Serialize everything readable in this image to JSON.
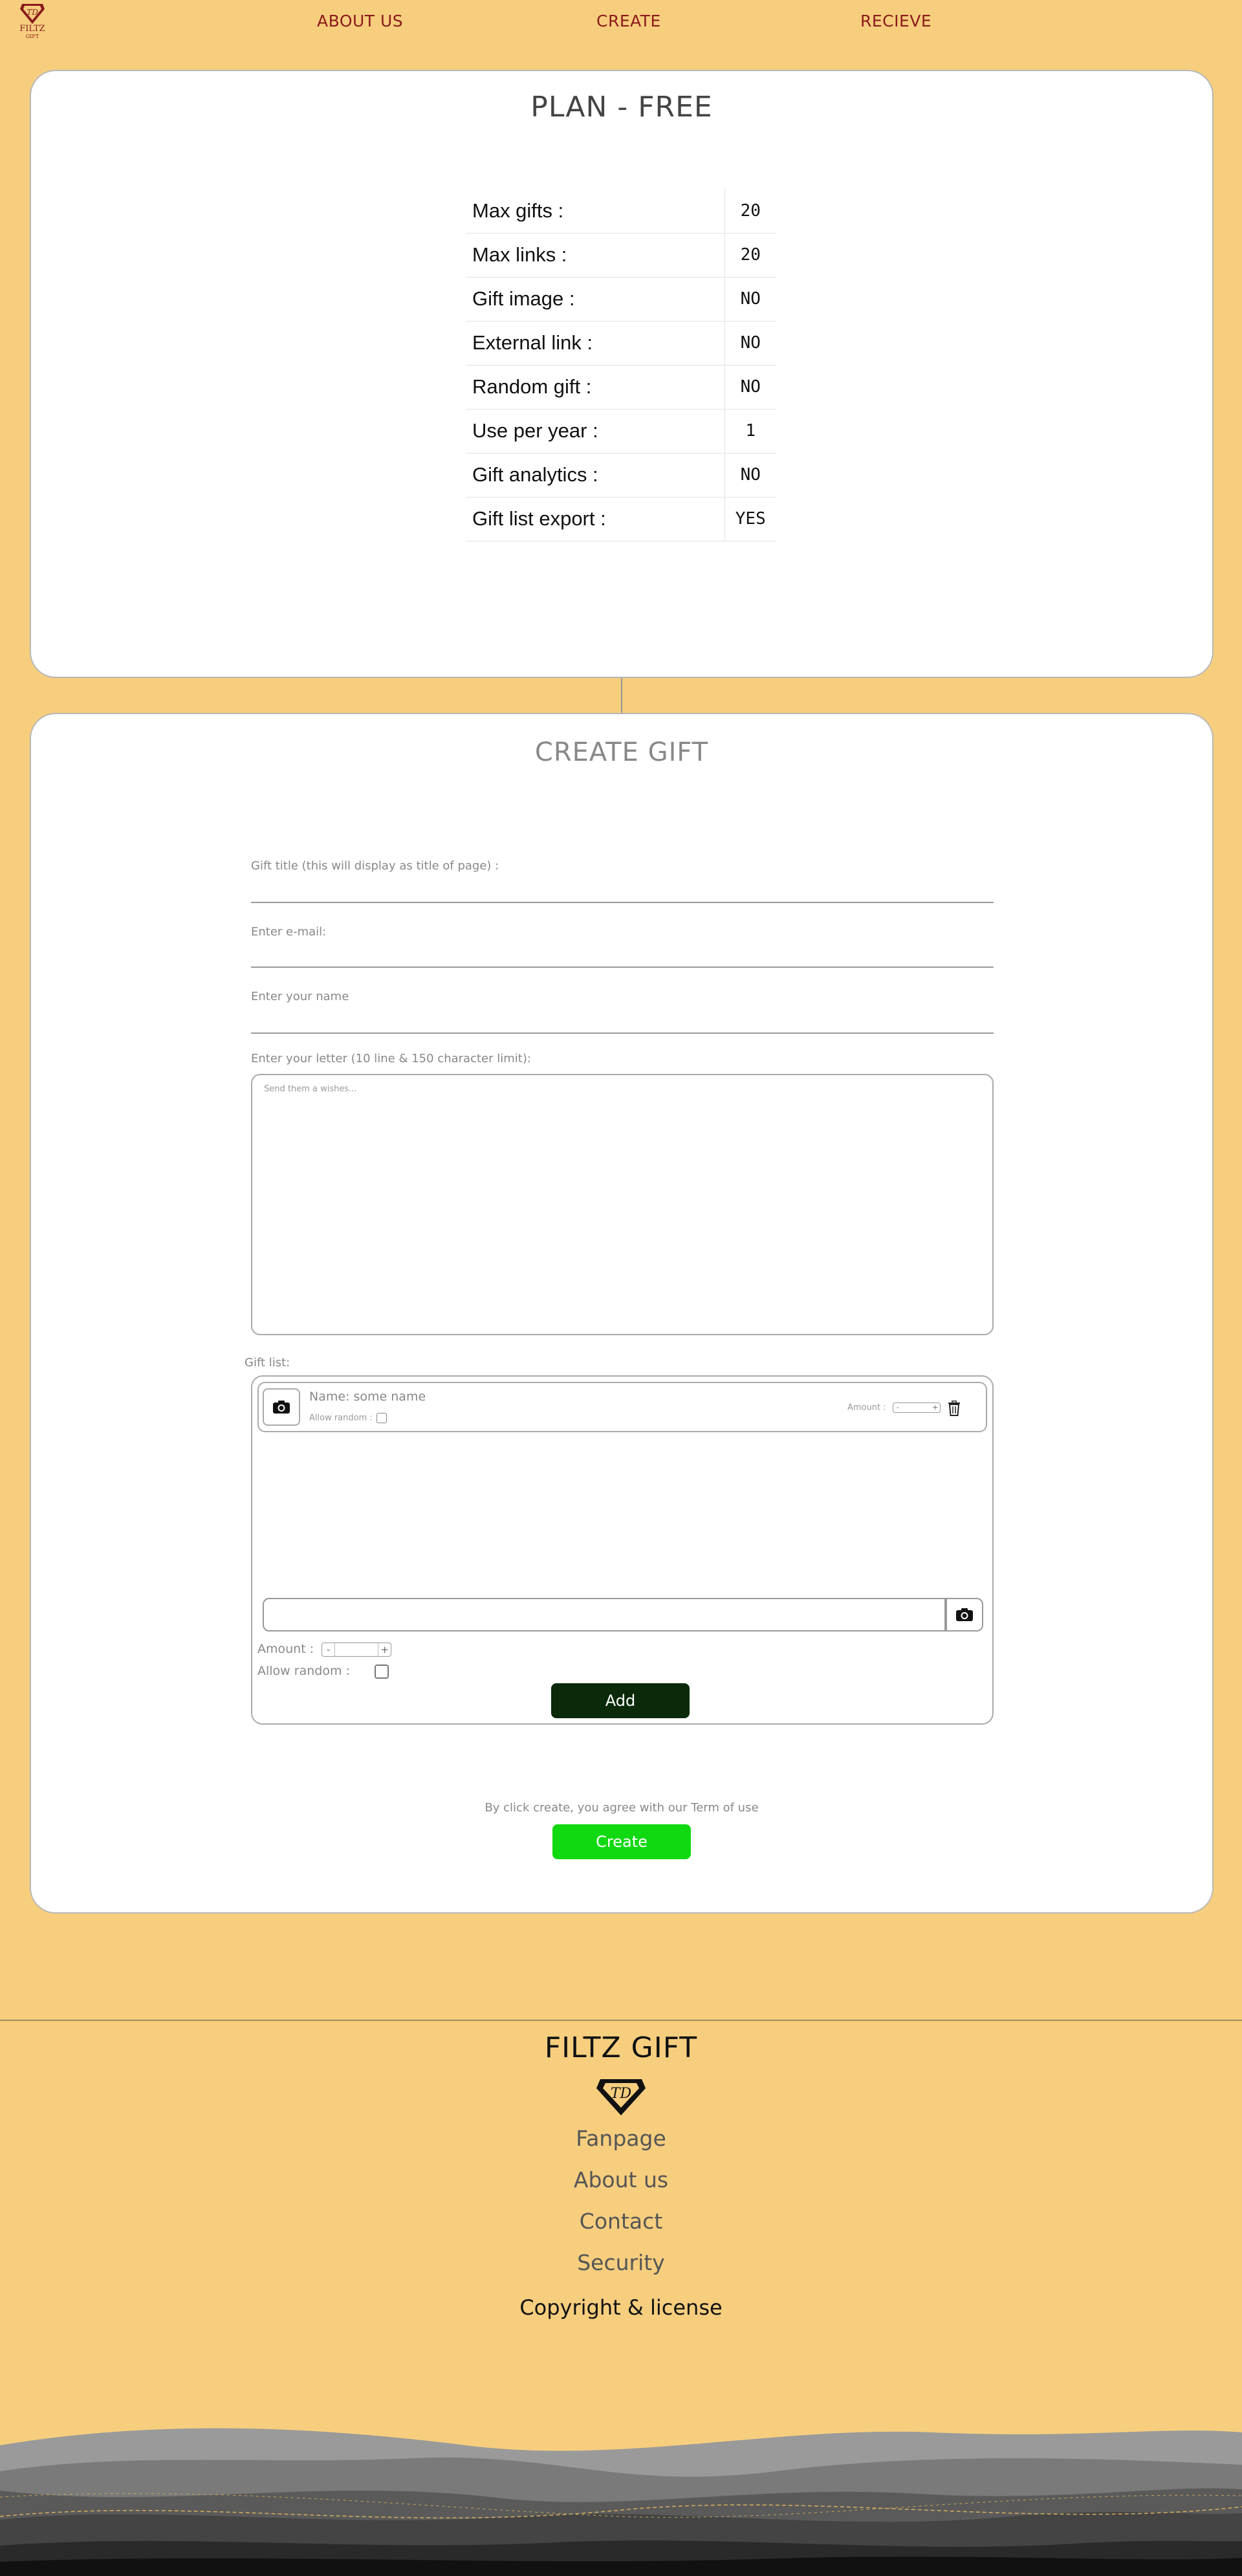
{
  "nav": {
    "logo_text": "FILTZ",
    "logo_sub": "GIFT",
    "links": [
      "ABOUT US",
      "CREATE",
      "RECIEVE"
    ]
  },
  "plan": {
    "title": "PLAN - FREE",
    "rows": [
      {
        "label": "Max gifts :",
        "value": "20"
      },
      {
        "label": "Max links :",
        "value": "20"
      },
      {
        "label": "Gift image :",
        "value": "NO"
      },
      {
        "label": "External link :",
        "value": "NO"
      },
      {
        "label": "Random gift :",
        "value": "NO"
      },
      {
        "label": "Use per year :",
        "value": "1"
      },
      {
        "label": "Gift analytics :",
        "value": "NO"
      },
      {
        "label": "Gift list export :",
        "value": "YES"
      }
    ]
  },
  "create": {
    "title": "CREATE GIFT",
    "gift_title_label": "Gift title (this will display as title of page) :",
    "email_label": "Enter e-mail:",
    "name_label": "Enter your name",
    "letter_label": "Enter your letter (10 line & 150 character limit):",
    "letter_placeholder": "Send them a wishes...",
    "gift_list_label": "Gift list:",
    "item": {
      "name": "Name: some name",
      "allow_random": "Allow random :",
      "amount": "Amount :",
      "stepper_minus": "-",
      "stepper_plus": "+"
    },
    "new_item": {
      "amount_label": "Amount :",
      "stepper_minus": "-",
      "stepper_plus": "+",
      "allow_random_label": "Allow random :",
      "add_label": "Add"
    },
    "terms": "By click create, you agree with our Term of use",
    "create_label": "Create"
  },
  "footer": {
    "title": "FILTZ GIFT",
    "links": [
      "Fanpage",
      "About us",
      "Contact",
      "Security"
    ],
    "copyright": "Copyright & license"
  },
  "colors": {
    "background": "#f6ce7e",
    "nav_link": "#8b1a1a",
    "add_button": "#0a2a0a",
    "create_button": "#11d911"
  },
  "icons": [
    "diamond-logo-icon",
    "camera-icon",
    "trash-icon",
    "checkbox-icon"
  ]
}
